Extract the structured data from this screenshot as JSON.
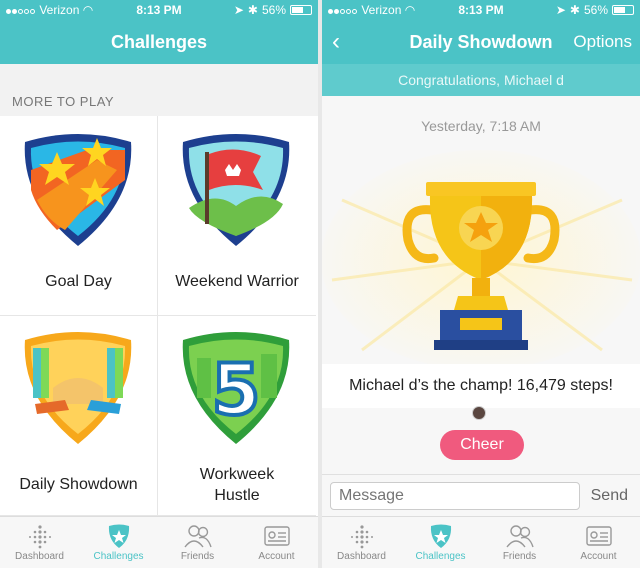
{
  "left": {
    "status": {
      "carrier": "Verizon",
      "time": "8:13 PM",
      "battery": "56%"
    },
    "nav": {
      "title": "Challenges"
    },
    "section_header": "MORE TO PLAY",
    "challenges": [
      {
        "label": "Goal Day"
      },
      {
        "label": "Weekend Warrior"
      },
      {
        "label": "Daily Showdown"
      },
      {
        "label": "Workweek\nHustle"
      }
    ],
    "badge_number": "5"
  },
  "right": {
    "status": {
      "carrier": "Verizon",
      "time": "8:13 PM",
      "battery": "56%"
    },
    "nav": {
      "back": "‹",
      "title": "Daily Showdown",
      "options": "Options"
    },
    "congrats": "Congratulations, Michael d",
    "timestamp": "Yesterday, 7:18 AM",
    "champ_text": "Michael d’s the champ! 16,479 steps!",
    "cheer_label": "Cheer",
    "message_placeholder": "Message",
    "send_label": "Send"
  },
  "tabs": [
    {
      "label": "Dashboard",
      "icon": "dashboard-dots-icon",
      "active": false
    },
    {
      "label": "Challenges",
      "icon": "challenges-star-badge-icon",
      "active": true
    },
    {
      "label": "Friends",
      "icon": "friends-people-icon",
      "active": false
    },
    {
      "label": "Account",
      "icon": "account-card-icon",
      "active": false
    }
  ],
  "colors": {
    "accent": "#4bc3c6",
    "cheer": "#f05a7e",
    "trophy": "#f5c518",
    "trophy_base": "#2a4fa0"
  }
}
